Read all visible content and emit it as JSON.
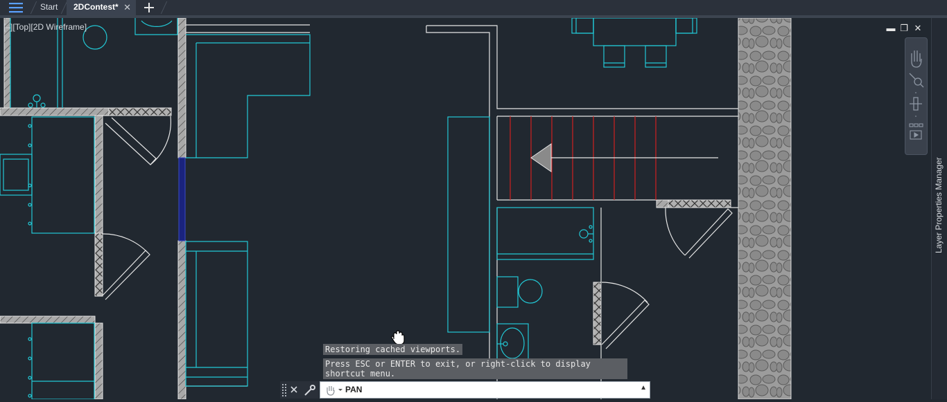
{
  "tabs": {
    "start_label": "Start",
    "active_label": "2DContest*",
    "close_glyph": "✕"
  },
  "viewport": {
    "label": "[–][Top][2D Wireframe]",
    "minimize_glyph": "▬",
    "restore_glyph": "❐",
    "close_glyph": "✕"
  },
  "side_panel": {
    "label": "Layer Properties Manager"
  },
  "command": {
    "message_1": "Restoring cached viewports.",
    "message_2": "Press ESC or ENTER to exit, or right-click to display shortcut menu.",
    "input_value": "PAN",
    "history_arrow": "▲"
  },
  "colors": {
    "background": "#212830",
    "wall_lines": "#e6e6e6",
    "furniture": "#22c9d6",
    "stair_lines": "#d02020",
    "wall_fill": "#9a9a9a",
    "window_fill": "#1a237e"
  },
  "icons": [
    "menu-icon",
    "add-tab-icon",
    "pan-hand-icon",
    "wrench-icon",
    "close-icon",
    "grip-icon",
    "navbar-pan-icon",
    "navbar-zoom-icon",
    "navbar-orbit-icon",
    "navbar-showmotion-icon",
    "cursor-hand-icon"
  ]
}
